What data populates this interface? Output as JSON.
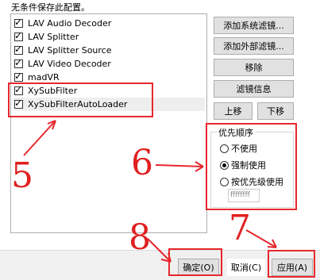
{
  "hint_text": "无条件保存此配置。",
  "filters": [
    {
      "label": "LAV Audio Decoder",
      "checked": "✓"
    },
    {
      "label": "LAV Splitter",
      "checked": "✓"
    },
    {
      "label": "LAV Splitter Source",
      "checked": "✓"
    },
    {
      "label": "LAV Video Decoder",
      "checked": "✓"
    },
    {
      "label": "madVR",
      "checked": "✓"
    },
    {
      "label": "XySubFilter",
      "checked": "✓"
    },
    {
      "label": "XySubFilterAutoLoader",
      "checked": "✓"
    }
  ],
  "buttons": {
    "add_system_filter": "添加系统滤镜...",
    "add_external_filter": "添加外部滤镜...",
    "remove": "移除",
    "filter_info": "滤镜信息",
    "move_up": "上移",
    "move_down": "下移"
  },
  "priority_group": {
    "title": "优先顺序",
    "options": [
      "不使用",
      "强制使用",
      "按优先级使用"
    ],
    "selected": "强制使用",
    "priority_value": "ffffffff"
  },
  "footer": {
    "ok": "确定(O)",
    "cancel": "取消(C)",
    "apply": "应用(A)"
  },
  "annotations": {
    "n5": "5",
    "n6": "6",
    "n7": "7",
    "n8": "8"
  },
  "colors": {
    "annotation": "#e8272d"
  }
}
